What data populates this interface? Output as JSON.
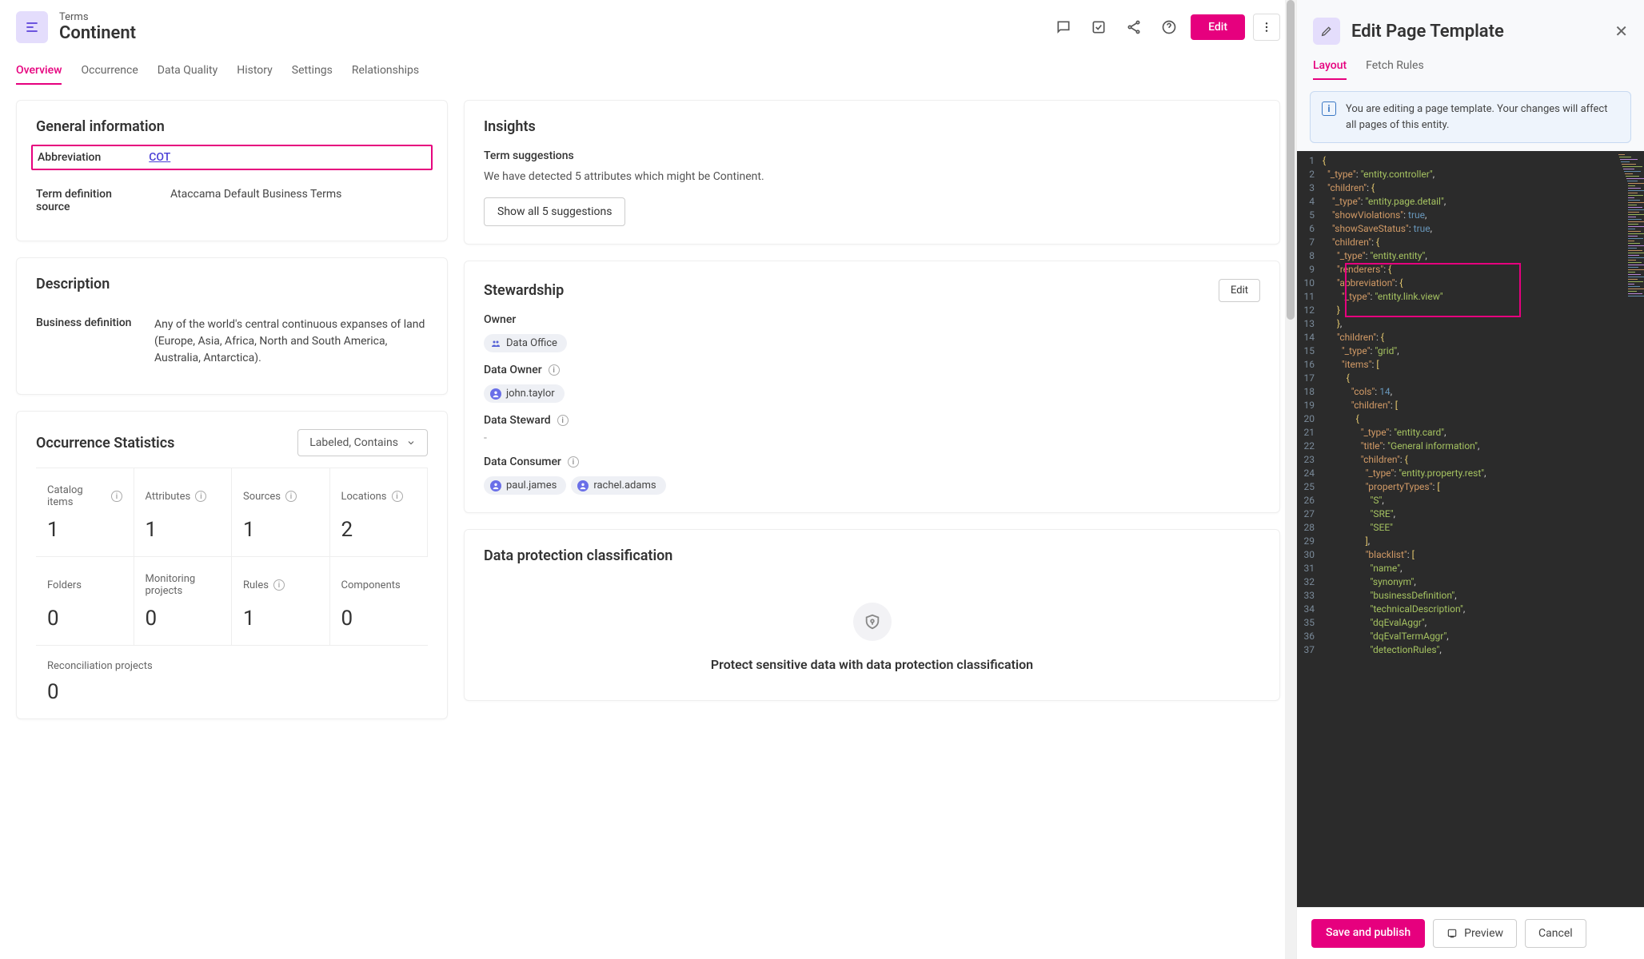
{
  "header": {
    "eyebrow": "Terms",
    "title": "Continent",
    "edit_label": "Edit"
  },
  "tabs": [
    "Overview",
    "Occurrence",
    "Data Quality",
    "History",
    "Settings",
    "Relationships"
  ],
  "general": {
    "title": "General information",
    "abbr_label": "Abbreviation",
    "abbr_value": "COT",
    "src_label": "Term definition source",
    "src_value": "Ataccama Default Business Terms"
  },
  "description": {
    "title": "Description",
    "label": "Business definition",
    "value": "Any of the world's central continuous expanses of land (Europe, Asia, Africa, North and South America, Australia, Antarctica)."
  },
  "occstats": {
    "title": "Occurrence Statistics",
    "filter": "Labeled, Contains",
    "stats": [
      {
        "label": "Catalog items",
        "value": "1",
        "info": true
      },
      {
        "label": "Attributes",
        "value": "1",
        "info": true
      },
      {
        "label": "Sources",
        "value": "1",
        "info": true
      },
      {
        "label": "Locations",
        "value": "2",
        "info": true
      },
      {
        "label": "Folders",
        "value": "0",
        "info": false
      },
      {
        "label": "Monitoring projects",
        "value": "0",
        "info": false
      },
      {
        "label": "Rules",
        "value": "1",
        "info": true
      },
      {
        "label": "Components",
        "value": "0",
        "info": false
      }
    ],
    "recon_label": "Reconciliation projects",
    "recon_value": "0"
  },
  "insights": {
    "title": "Insights",
    "subtitle": "Term suggestions",
    "text": "We have detected 5 attributes which might be Continent.",
    "button": "Show all 5 suggestions"
  },
  "stewardship": {
    "title": "Stewardship",
    "edit_label": "Edit",
    "owner_label": "Owner",
    "owner_chip": "Data Office",
    "data_owner_label": "Data Owner",
    "data_owner_chip": "john.taylor",
    "data_steward_label": "Data Steward",
    "data_steward_value": "-",
    "data_consumer_label": "Data Consumer",
    "data_consumer_chips": [
      "paul.james",
      "rachel.adams"
    ]
  },
  "protection": {
    "title": "Data protection classification",
    "hero": "Protect sensitive data with data protection classification"
  },
  "rightpanel": {
    "title": "Edit Page Template",
    "tabs": [
      "Layout",
      "Fetch Rules"
    ],
    "notice": "You are editing a page template. Your changes will affect all pages of this entity.",
    "save": "Save and publish",
    "preview": "Preview",
    "cancel": "Cancel"
  },
  "code_lines": [
    {
      "n": 1,
      "indent": 0,
      "tokens": [
        [
          "y",
          "{"
        ]
      ]
    },
    {
      "n": 2,
      "indent": 1,
      "tokens": [
        [
          "key",
          "\"_type\""
        ],
        [
          "p",
          ": "
        ],
        [
          "str",
          "\"entity.controller\""
        ],
        [
          "p",
          ","
        ]
      ]
    },
    {
      "n": 3,
      "indent": 1,
      "tokens": [
        [
          "key",
          "\"children\""
        ],
        [
          "p",
          ": "
        ],
        [
          "y",
          "{"
        ]
      ]
    },
    {
      "n": 4,
      "indent": 2,
      "tokens": [
        [
          "key",
          "\"_type\""
        ],
        [
          "p",
          ": "
        ],
        [
          "str",
          "\"entity.page.detail\""
        ],
        [
          "p",
          ","
        ]
      ]
    },
    {
      "n": 5,
      "indent": 2,
      "tokens": [
        [
          "key",
          "\"showViolations\""
        ],
        [
          "p",
          ": "
        ],
        [
          "bool",
          "true"
        ],
        [
          "p",
          ","
        ]
      ]
    },
    {
      "n": 6,
      "indent": 2,
      "tokens": [
        [
          "key",
          "\"showSaveStatus\""
        ],
        [
          "p",
          ": "
        ],
        [
          "bool",
          "true"
        ],
        [
          "p",
          ","
        ]
      ]
    },
    {
      "n": 7,
      "indent": 2,
      "tokens": [
        [
          "key",
          "\"children\""
        ],
        [
          "p",
          ": "
        ],
        [
          "y",
          "{"
        ]
      ]
    },
    {
      "n": 8,
      "indent": 3,
      "tokens": [
        [
          "key",
          "\"_type\""
        ],
        [
          "p",
          ": "
        ],
        [
          "str",
          "\"entity.entity\""
        ],
        [
          "p",
          ","
        ]
      ]
    },
    {
      "n": 9,
      "indent": 3,
      "tokens": [
        [
          "key",
          "\"renderers\""
        ],
        [
          "p",
          ": "
        ],
        [
          "y",
          "{"
        ]
      ]
    },
    {
      "n": 10,
      "indent": 3,
      "tokens": [
        [
          "key",
          "\"abbreviation\""
        ],
        [
          "p",
          ": "
        ],
        [
          "y",
          "{"
        ]
      ]
    },
    {
      "n": 11,
      "indent": 4,
      "tokens": [
        [
          "key",
          "\"_type\""
        ],
        [
          "p",
          ": "
        ],
        [
          "str",
          "\"entity.link.view\""
        ]
      ]
    },
    {
      "n": 12,
      "indent": 3,
      "tokens": [
        [
          "y",
          "}"
        ]
      ]
    },
    {
      "n": 13,
      "indent": 3,
      "tokens": [
        [
          "y",
          "}"
        ],
        [
          "p",
          ","
        ]
      ]
    },
    {
      "n": 14,
      "indent": 3,
      "tokens": [
        [
          "key",
          "\"children\""
        ],
        [
          "p",
          ": "
        ],
        [
          "y",
          "{"
        ]
      ]
    },
    {
      "n": 15,
      "indent": 4,
      "tokens": [
        [
          "key",
          "\"_type\""
        ],
        [
          "p",
          ": "
        ],
        [
          "str",
          "\"grid\""
        ],
        [
          "p",
          ","
        ]
      ]
    },
    {
      "n": 16,
      "indent": 4,
      "tokens": [
        [
          "key",
          "\"items\""
        ],
        [
          "p",
          ": "
        ],
        [
          "y",
          "["
        ]
      ]
    },
    {
      "n": 17,
      "indent": 5,
      "tokens": [
        [
          "y",
          "{"
        ]
      ]
    },
    {
      "n": 18,
      "indent": 6,
      "tokens": [
        [
          "key",
          "\"cols\""
        ],
        [
          "p",
          ": "
        ],
        [
          "bool",
          "14"
        ],
        [
          "p",
          ","
        ]
      ]
    },
    {
      "n": 19,
      "indent": 6,
      "tokens": [
        [
          "key",
          "\"children\""
        ],
        [
          "p",
          ": "
        ],
        [
          "y",
          "["
        ]
      ]
    },
    {
      "n": 20,
      "indent": 7,
      "tokens": [
        [
          "y",
          "{"
        ]
      ]
    },
    {
      "n": 21,
      "indent": 8,
      "tokens": [
        [
          "key",
          "\"_type\""
        ],
        [
          "p",
          ": "
        ],
        [
          "str",
          "\"entity.card\""
        ],
        [
          "p",
          ","
        ]
      ]
    },
    {
      "n": 22,
      "indent": 8,
      "tokens": [
        [
          "key",
          "\"title\""
        ],
        [
          "p",
          ": "
        ],
        [
          "str",
          "\"General information\""
        ],
        [
          "p",
          ","
        ]
      ]
    },
    {
      "n": 23,
      "indent": 8,
      "tokens": [
        [
          "key",
          "\"children\""
        ],
        [
          "p",
          ": "
        ],
        [
          "y",
          "{"
        ]
      ]
    },
    {
      "n": 24,
      "indent": 9,
      "tokens": [
        [
          "key",
          "\"_type\""
        ],
        [
          "p",
          ": "
        ],
        [
          "str",
          "\"entity.property.rest\""
        ],
        [
          "p",
          ","
        ]
      ]
    },
    {
      "n": 25,
      "indent": 9,
      "tokens": [
        [
          "key",
          "\"propertyTypes\""
        ],
        [
          "p",
          ": "
        ],
        [
          "y",
          "["
        ]
      ]
    },
    {
      "n": 26,
      "indent": 10,
      "tokens": [
        [
          "str",
          "\"S\""
        ],
        [
          "p",
          ","
        ]
      ]
    },
    {
      "n": 27,
      "indent": 10,
      "tokens": [
        [
          "str",
          "\"SRE\""
        ],
        [
          "p",
          ","
        ]
      ]
    },
    {
      "n": 28,
      "indent": 10,
      "tokens": [
        [
          "str",
          "\"SEE\""
        ]
      ]
    },
    {
      "n": 29,
      "indent": 9,
      "tokens": [
        [
          "y",
          "]"
        ],
        [
          "p",
          ","
        ]
      ]
    },
    {
      "n": 30,
      "indent": 9,
      "tokens": [
        [
          "key",
          "\"blacklist\""
        ],
        [
          "p",
          ": "
        ],
        [
          "y",
          "["
        ]
      ]
    },
    {
      "n": 31,
      "indent": 10,
      "tokens": [
        [
          "str",
          "\"name\""
        ],
        [
          "p",
          ","
        ]
      ]
    },
    {
      "n": 32,
      "indent": 10,
      "tokens": [
        [
          "str",
          "\"synonym\""
        ],
        [
          "p",
          ","
        ]
      ]
    },
    {
      "n": 33,
      "indent": 10,
      "tokens": [
        [
          "str",
          "\"businessDefinition\""
        ],
        [
          "p",
          ","
        ]
      ]
    },
    {
      "n": 34,
      "indent": 10,
      "tokens": [
        [
          "str",
          "\"technicalDescription\""
        ],
        [
          "p",
          ","
        ]
      ]
    },
    {
      "n": 35,
      "indent": 10,
      "tokens": [
        [
          "str",
          "\"dqEvalAggr\""
        ],
        [
          "p",
          ","
        ]
      ]
    },
    {
      "n": 36,
      "indent": 10,
      "tokens": [
        [
          "str",
          "\"dqEvalTermAggr\""
        ],
        [
          "p",
          ","
        ]
      ]
    },
    {
      "n": 37,
      "indent": 10,
      "tokens": [
        [
          "str",
          "\"detectionRules\""
        ],
        [
          "p",
          ","
        ]
      ]
    }
  ]
}
